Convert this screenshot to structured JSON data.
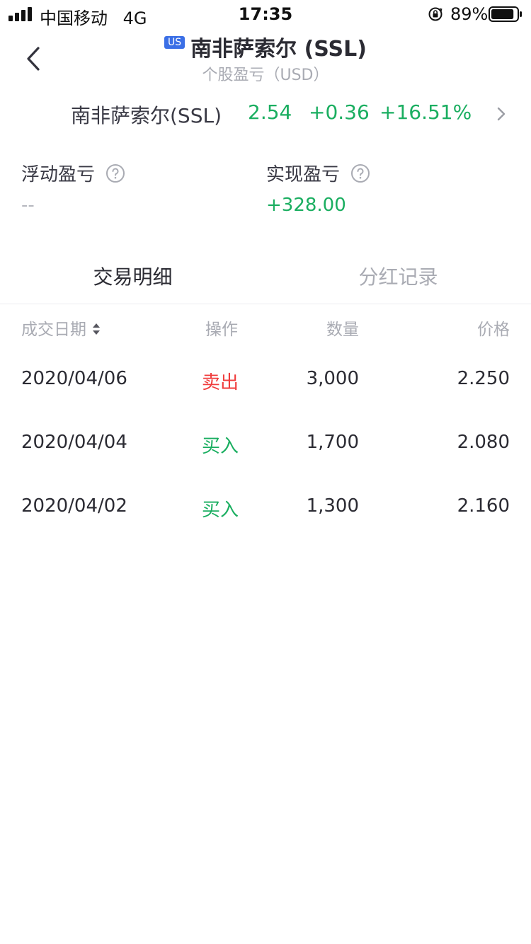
{
  "status_bar": {
    "carrier": "中国移动",
    "network": "4G",
    "time": "17:35",
    "battery": "89%",
    "battery_level": 0.89
  },
  "header": {
    "market_badge": "US",
    "title": "南非萨索尔 (SSL)",
    "subtitle": "个股盈亏（USD）"
  },
  "quote": {
    "name": "南非萨索尔(SSL)",
    "price": "2.54",
    "change": "+0.36",
    "change_pct": "+16.51%"
  },
  "pnl": {
    "floating_label": "浮动盈亏",
    "floating_value": "--",
    "realized_label": "实现盈亏",
    "realized_value": "+328.00"
  },
  "tabs": [
    {
      "label": "交易明细",
      "active": true
    },
    {
      "label": "分红记录",
      "active": false
    }
  ],
  "table": {
    "headers": {
      "date": "成交日期",
      "op": "操作",
      "qty": "数量",
      "price": "价格"
    },
    "rows": [
      {
        "date": "2020/04/06",
        "op": "卖出",
        "side": "sell",
        "qty": "3,000",
        "price": "2.250"
      },
      {
        "date": "2020/04/04",
        "op": "买入",
        "side": "buy",
        "qty": "1,700",
        "price": "2.080"
      },
      {
        "date": "2020/04/02",
        "op": "买入",
        "side": "buy",
        "qty": "1,300",
        "price": "2.160"
      }
    ]
  },
  "colors": {
    "up": "#1aae60",
    "down": "#f03c3c",
    "badge": "#3b6fe6"
  },
  "icons": {
    "back": "chevron-left-icon",
    "quote_arrow": "chevron-right-icon",
    "help": "question-circle-icon",
    "sort": "sort-icon"
  }
}
